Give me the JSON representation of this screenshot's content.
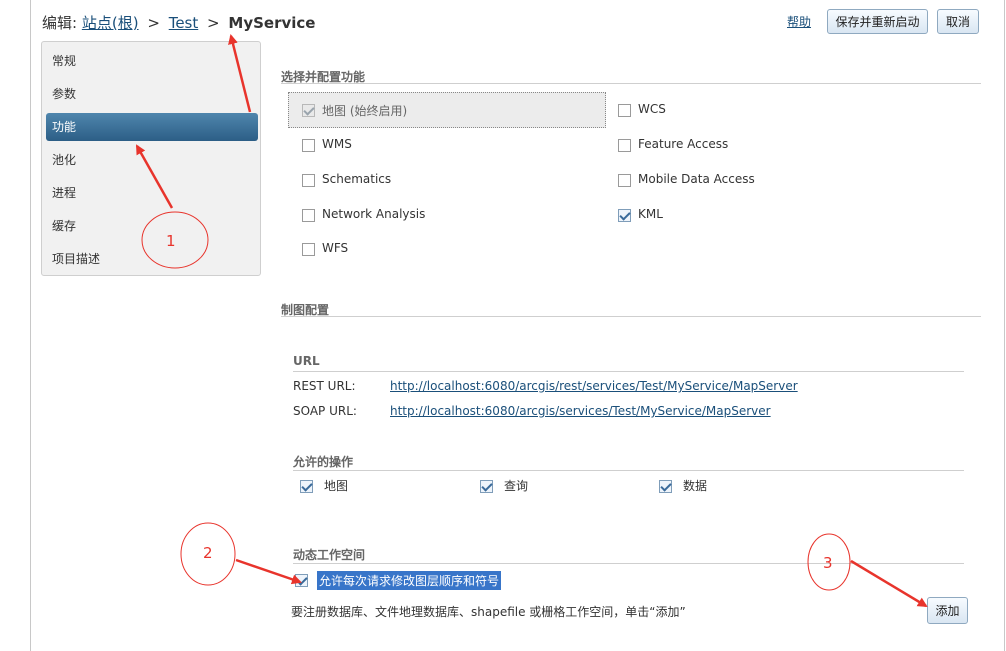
{
  "header": {
    "prefix": "编辑:",
    "breadcrumb": [
      "站点(根)",
      "Test"
    ],
    "separator": ">",
    "current": "MyService"
  },
  "toolbar": {
    "help": "帮助",
    "save_restart": "保存并重新启动",
    "cancel": "取消"
  },
  "sidebar": {
    "items": [
      {
        "label": "常规"
      },
      {
        "label": "参数"
      },
      {
        "label": "功能",
        "active": true
      },
      {
        "label": "池化"
      },
      {
        "label": "进程"
      },
      {
        "label": "缓存"
      },
      {
        "label": "项目描述"
      }
    ]
  },
  "capabilities": {
    "title": "选择并配置功能",
    "items": [
      {
        "label": "地图 (始终启用)",
        "checked": true,
        "disabled": true
      },
      {
        "label": "WCS",
        "checked": false
      },
      {
        "label": "WMS",
        "checked": false
      },
      {
        "label": "Feature Access",
        "checked": false
      },
      {
        "label": "Schematics",
        "checked": false
      },
      {
        "label": "Mobile Data Access",
        "checked": false
      },
      {
        "label": "Network Analysis",
        "checked": false
      },
      {
        "label": "KML",
        "checked": true
      },
      {
        "label": "WFS",
        "checked": false
      }
    ]
  },
  "mapping": {
    "title": "制图配置",
    "url_title": "URL",
    "rest_label": "REST URL:",
    "rest_url": "http://localhost:6080/arcgis/rest/services/Test/MyService/MapServer",
    "soap_label": "SOAP URL:",
    "soap_url": "http://localhost:6080/arcgis/services/Test/MyService/MapServer",
    "ops_title": "允许的操作",
    "operations": [
      {
        "label": "地图",
        "checked": true
      },
      {
        "label": "查询",
        "checked": true
      },
      {
        "label": "数据",
        "checked": true
      }
    ],
    "dynamic_title": "动态工作空间",
    "dynamic_option": "允许每次请求修改图层顺序和符号",
    "dynamic_checked": true,
    "note": "要注册数据库、文件地理数据库、shapefile 或栅格工作空间，单击“添加”",
    "add": "添加"
  },
  "annotations": {
    "labels": [
      "1",
      "2",
      "3"
    ],
    "color": "#e8342c"
  }
}
